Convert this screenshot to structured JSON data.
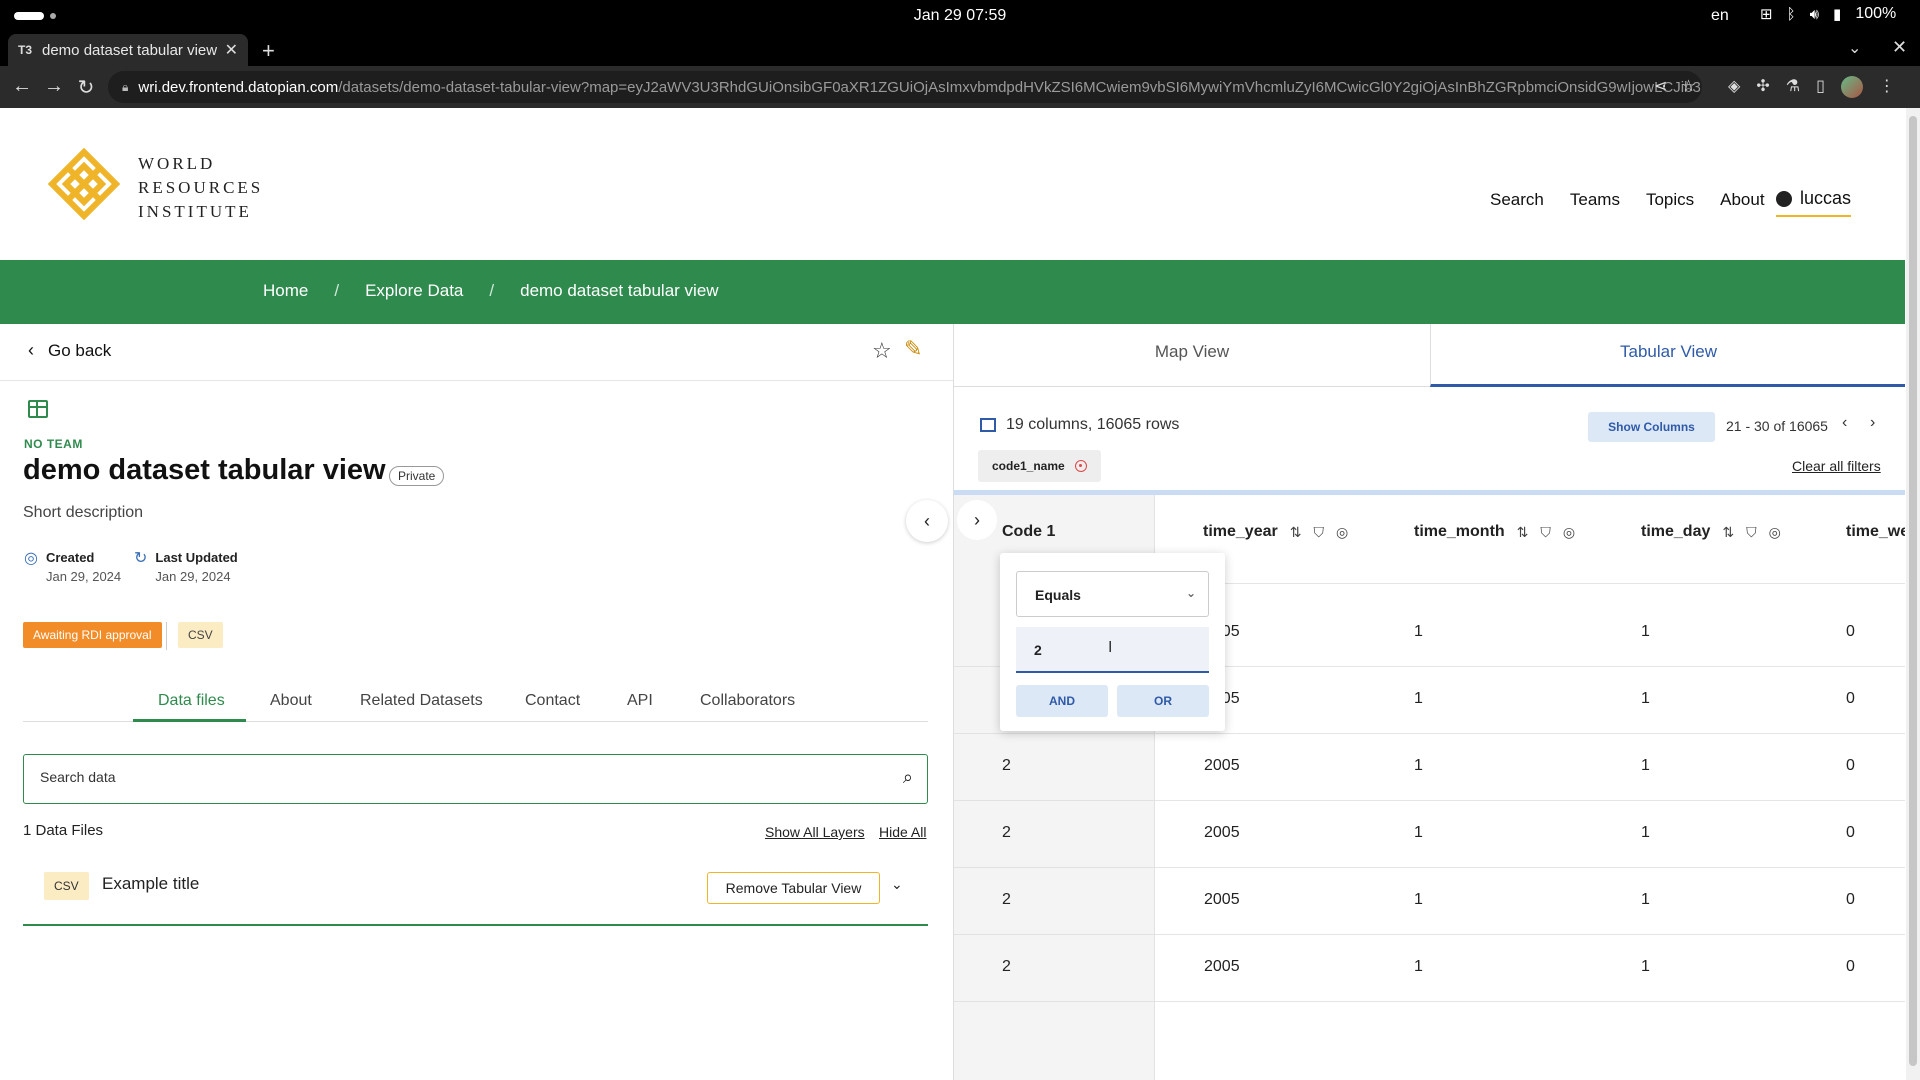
{
  "os": {
    "datetime": "Jan 29  07:59",
    "lang": "en",
    "battery": "100%"
  },
  "browser": {
    "tab_title": "demo dataset tabular view",
    "url_host": "wri.dev.frontend.datopian.com",
    "url_path": "/datasets/demo-dataset-tabular-view?map=eyJ2aWV3U3RhdGUiOnsibGF0aXR1ZGUiOjAsImxvbmdpdHVkZSI6MCwiem9vbSI6MywiYmVhcmluZyI6MCwicGl0Y2giOjAsInBhZGRpbmciOnsidG9wIjowLCJib3R0b20i..."
  },
  "site": {
    "logo_lines": [
      "WORLD",
      "RESOURCES",
      "INSTITUTE"
    ],
    "nav": [
      "Search",
      "Teams",
      "Topics",
      "About"
    ],
    "user": "luccas"
  },
  "breadcrumb": {
    "home": "Home",
    "explore": "Explore Data",
    "current": "demo dataset tabular view"
  },
  "dataset": {
    "go_back": "Go back",
    "team": "NO TEAM",
    "title": "demo dataset tabular view",
    "visibility": "Private",
    "description": "Short description",
    "created_label": "Created",
    "created_date": "Jan 29, 2024",
    "updated_label": "Last Updated",
    "updated_date": "Jan 29, 2024",
    "status_badge": "Awaiting RDI approval",
    "format_badge": "CSV",
    "tabs": [
      "Data files",
      "About",
      "Related Datasets",
      "Contact",
      "API",
      "Collaborators"
    ],
    "search_placeholder": "Search data",
    "files_count": "1 Data Files",
    "show_all_layers": "Show All Layers",
    "hide_all": "Hide All",
    "file": {
      "format": "CSV",
      "title": "Example title",
      "remove_button": "Remove Tabular View"
    }
  },
  "viewer": {
    "tabs": {
      "map": "Map View",
      "tabular": "Tabular View"
    },
    "columns_info": "19 columns, 16065 rows",
    "show_columns": "Show Columns",
    "pager": "21 - 30 of 16065",
    "filter_chip": "code1_name",
    "clear_filters": "Clear all filters",
    "columns": [
      "Code 1",
      "time_year",
      "time_month",
      "time_day",
      "time_we"
    ],
    "rows": [
      [
        "",
        "2005",
        "1",
        "1",
        "0"
      ],
      [
        "2",
        "2005",
        "1",
        "1",
        "0"
      ],
      [
        "2",
        "2005",
        "1",
        "1",
        "0"
      ],
      [
        "2",
        "2005",
        "1",
        "1",
        "0"
      ],
      [
        "2",
        "2005",
        "1",
        "1",
        "0"
      ],
      [
        "2",
        "2005",
        "1",
        "1",
        "0"
      ]
    ],
    "filter_popover": {
      "operator": "Equals",
      "value": "2",
      "and_label": "AND",
      "or_label": "OR"
    }
  },
  "colors": {
    "green": "#2f8b4d",
    "blue": "#2f5aa8",
    "orange": "#f28c28",
    "gold": "#f0b429"
  }
}
